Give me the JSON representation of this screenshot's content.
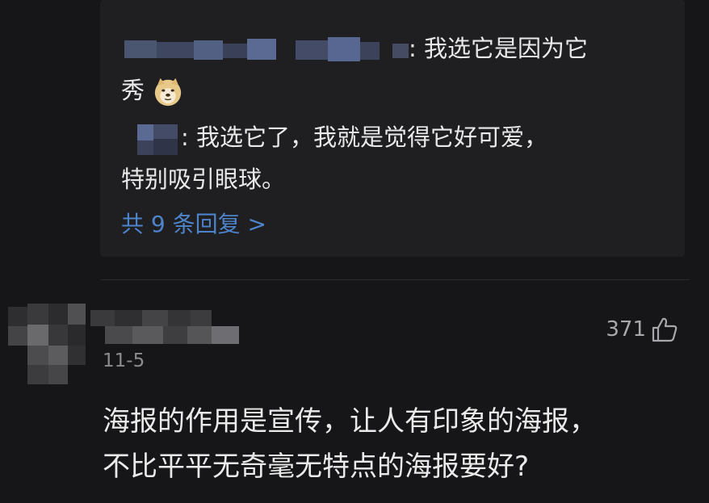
{
  "replies": [
    {
      "text_line1": ": 我选它是因为它",
      "text_line2": "秀",
      "emoji": "doge-emoji"
    },
    {
      "text_line1": ": 我选它了，我就是觉得它好可爱，",
      "text_line2": "特别吸引眼球。"
    }
  ],
  "view_more": "共 9 条回复 >",
  "comment": {
    "date": "11-5",
    "likes": "371",
    "like_icon": "thumbs-up-icon",
    "text_line1": "海报的作用是宣传，让人有印象的海报，",
    "text_line2": "不比平平无奇毫无特点的海报要好?"
  },
  "colors": {
    "background": "#161618",
    "reply_box": "#1f1f22",
    "link_blue": "#4d83c9",
    "muted": "#8c8c90"
  }
}
